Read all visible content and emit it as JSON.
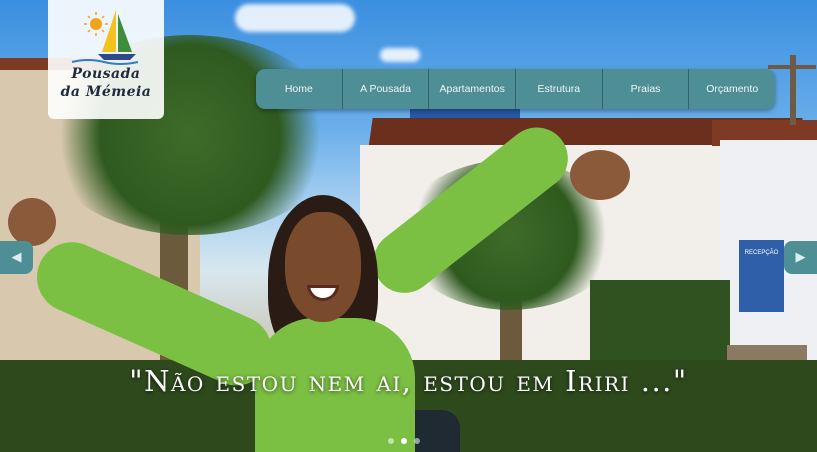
{
  "logo": {
    "line1": "Pousada",
    "line2": "da Mémeia"
  },
  "nav": {
    "items": [
      {
        "label": "Home"
      },
      {
        "label": "A Pousada"
      },
      {
        "label": "Apartamentos"
      },
      {
        "label": "Estrutura"
      },
      {
        "label": "Praias"
      },
      {
        "label": "Orçamento"
      }
    ]
  },
  "slider": {
    "prev_icon": "chevron-left-icon",
    "next_icon": "chevron-right-icon",
    "caption": "\"Não estou nem ai, estou em Iriri ...\"",
    "dot_count": 3,
    "active_dot": 1
  },
  "scene": {
    "sign_text": "RECEPÇÃO"
  },
  "colors": {
    "nav_bg": "#4e8f96",
    "nav_text": "#eef6f6",
    "caption": "#ffffff"
  }
}
